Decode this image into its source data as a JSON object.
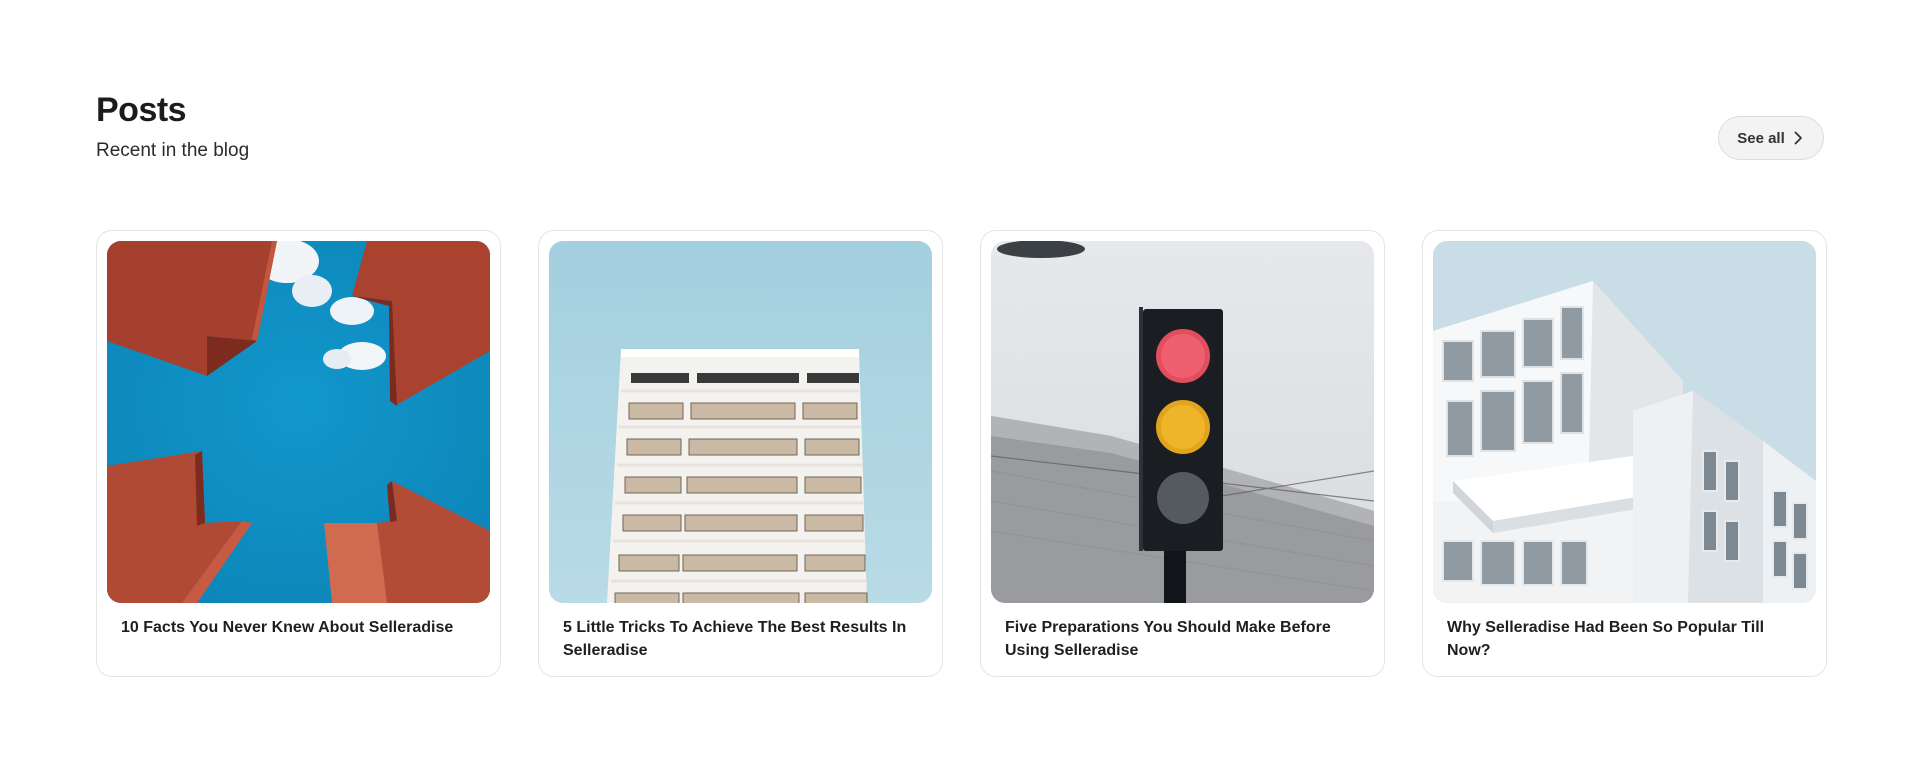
{
  "header": {
    "title": "Posts",
    "subtitle": "Recent in the blog",
    "see_all_label": "See all",
    "see_all_icon": "chevron-right-icon"
  },
  "posts": [
    {
      "title": "10 Facts You Never Knew About Selleradise",
      "image": "red-steel-sculpture-against-blue-sky"
    },
    {
      "title": "5 Little Tricks To Achieve The Best Results In Selleradise",
      "image": "white-tower-building-against-pale-blue-sky"
    },
    {
      "title": "Five Preparations You Should Make Before Using Selleradise",
      "image": "traffic-light-red-yellow-against-grey-roof"
    },
    {
      "title": "Why Selleradise Had Been So Popular Till Now?",
      "image": "modern-white-cubic-building-against-sky"
    }
  ],
  "colors": {
    "sky_blue": "#0d8fc4",
    "rust_red": "#a5402f",
    "pale_sky": "#a9d1e0",
    "light_grey_sky": "#e4e6ea",
    "pale_blue_sky": "#c9dde6"
  }
}
